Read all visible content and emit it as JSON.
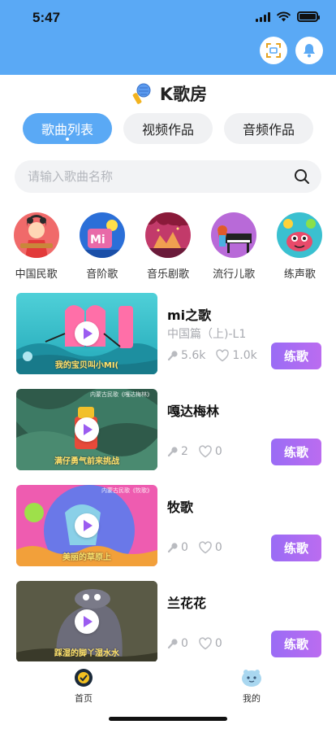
{
  "status": {
    "time": "5:47"
  },
  "header": {
    "title": "K歌房"
  },
  "tabs": [
    {
      "label": "歌曲列表",
      "active": true
    },
    {
      "label": "视频作品",
      "active": false
    },
    {
      "label": "音频作品",
      "active": false
    }
  ],
  "search": {
    "placeholder": "请输入歌曲名称",
    "value": ""
  },
  "categories": [
    {
      "label": "中国民歌"
    },
    {
      "label": "音阶歌"
    },
    {
      "label": "音乐剧歌"
    },
    {
      "label": "流行儿歌"
    },
    {
      "label": "练声歌"
    }
  ],
  "songs": [
    {
      "title": "mi之歌",
      "subtitle": "中国篇（上)-L1",
      "plays": "5.6k",
      "likes": "1.0k",
      "caption": "我的宝贝叫小MI(",
      "button": "练歌"
    },
    {
      "title": "嘎达梅林",
      "subtitle": "",
      "plays": "2",
      "likes": "0",
      "caption": "满仔勇气前来挑战",
      "tag": "内蒙古民歌《嘎达梅林》",
      "button": "练歌"
    },
    {
      "title": "牧歌",
      "subtitle": "",
      "plays": "0",
      "likes": "0",
      "caption": "美丽的草原上",
      "tag": "内蒙古民歌《牧歌》",
      "button": "练歌"
    },
    {
      "title": "兰花花",
      "subtitle": "",
      "plays": "0",
      "likes": "0",
      "caption": "踩湿的脚丫湿水水",
      "button": "练歌"
    }
  ],
  "tabbar": [
    {
      "label": "首页",
      "active": true
    },
    {
      "label": "我的",
      "active": false
    }
  ],
  "colors": {
    "accent": "#5aa9f5",
    "practice": "#a66cf2"
  }
}
